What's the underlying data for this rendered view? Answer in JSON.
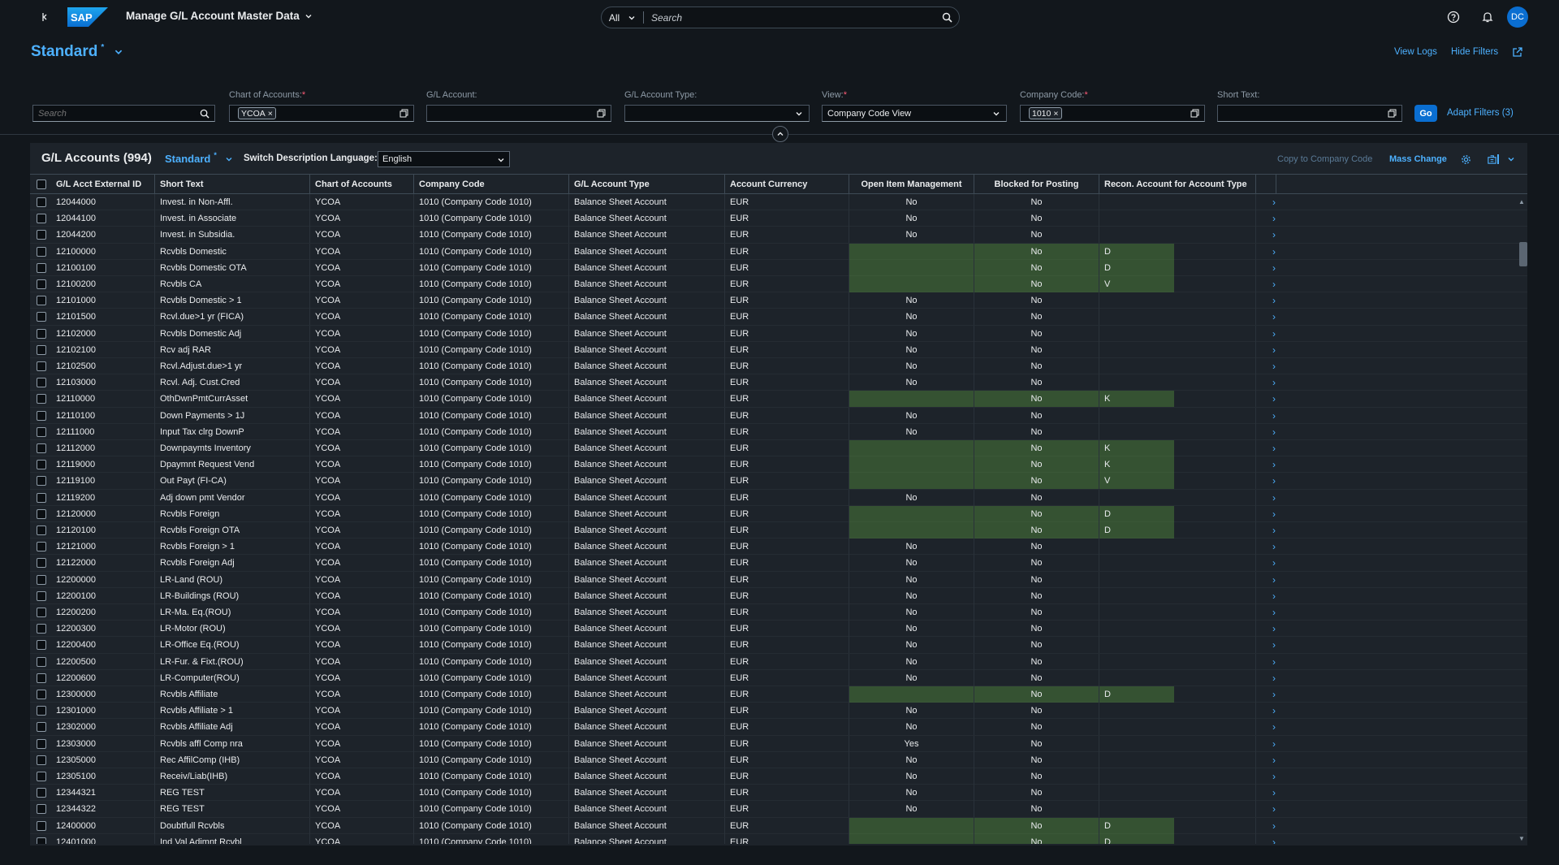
{
  "shell": {
    "back_icon": "back-icon",
    "logo_text": "SAP",
    "app_title": "Manage G/L Account Master Data",
    "search_scope": "All",
    "search_placeholder": "Search",
    "icons": [
      "help-icon",
      "notification-icon"
    ],
    "avatar_initials": "DC"
  },
  "header": {
    "variant": "Standard",
    "variant_mark": "*",
    "links": {
      "view_logs": "View Logs",
      "hide_filters": "Hide Filters"
    }
  },
  "filters": {
    "search_placeholder": "Search",
    "chart_of_accounts": {
      "label": "Chart of Accounts:",
      "required": "*",
      "token": "YCOA"
    },
    "gl_account": {
      "label": "G/L Account:",
      "value": ""
    },
    "gl_account_type": {
      "label": "G/L Account Type:",
      "value": ""
    },
    "view": {
      "label": "View:",
      "required": "*",
      "value": "Company Code View"
    },
    "company_code": {
      "label": "Company Code:",
      "required": "*",
      "token": "1010"
    },
    "short_text": {
      "label": "Short Text:",
      "value": ""
    },
    "go_label": "Go",
    "adapt_label": "Adapt Filters (3)"
  },
  "table": {
    "title": "G/L Accounts (994)",
    "variant": "Standard",
    "variant_mark": "*",
    "lang_label": "Switch Description Language:",
    "lang_value": "English",
    "copy_label": "Copy to Company Code",
    "mass_change_label": "Mass Change",
    "columns": [
      "G/L Acct External ID",
      "Short Text",
      "Chart of Accounts",
      "Company Code",
      "G/L Account Type",
      "Account Currency",
      "Open Item Management",
      "Blocked for Posting",
      "Recon. Account for Account Type"
    ],
    "rows": [
      [
        "12044000",
        "Invest. in Non-Affl.",
        "YCOA",
        "1010 (Company Code 1010)",
        "Balance Sheet Account",
        "EUR",
        "No",
        "No",
        ""
      ],
      [
        "12044100",
        "Invest. in Associate",
        "YCOA",
        "1010 (Company Code 1010)",
        "Balance Sheet Account",
        "EUR",
        "No",
        "No",
        ""
      ],
      [
        "12044200",
        "Invest. in Subsidia.",
        "YCOA",
        "1010 (Company Code 1010)",
        "Balance Sheet Account",
        "EUR",
        "No",
        "No",
        ""
      ],
      [
        "12100000",
        "Rcvbls Domestic",
        "YCOA",
        "1010 (Company Code 1010)",
        "Balance Sheet Account",
        "EUR",
        "",
        "No",
        "D"
      ],
      [
        "12100100",
        "Rcvbls Domestic OTA",
        "YCOA",
        "1010 (Company Code 1010)",
        "Balance Sheet Account",
        "EUR",
        "",
        "No",
        "D"
      ],
      [
        "12100200",
        "Rcvbls CA",
        "YCOA",
        "1010 (Company Code 1010)",
        "Balance Sheet Account",
        "EUR",
        "",
        "No",
        "V"
      ],
      [
        "12101000",
        "Rcvbls Domestic > 1",
        "YCOA",
        "1010 (Company Code 1010)",
        "Balance Sheet Account",
        "EUR",
        "No",
        "No",
        ""
      ],
      [
        "12101500",
        "Rcvl.due>1 yr (FICA)",
        "YCOA",
        "1010 (Company Code 1010)",
        "Balance Sheet Account",
        "EUR",
        "No",
        "No",
        ""
      ],
      [
        "12102000",
        "Rcvbls Domestic Adj",
        "YCOA",
        "1010 (Company Code 1010)",
        "Balance Sheet Account",
        "EUR",
        "No",
        "No",
        ""
      ],
      [
        "12102100",
        "Rcv adj RAR",
        "YCOA",
        "1010 (Company Code 1010)",
        "Balance Sheet Account",
        "EUR",
        "No",
        "No",
        ""
      ],
      [
        "12102500",
        "Rcvl.Adjust.due>1 yr",
        "YCOA",
        "1010 (Company Code 1010)",
        "Balance Sheet Account",
        "EUR",
        "No",
        "No",
        ""
      ],
      [
        "12103000",
        "Rcvl. Adj. Cust.Cred",
        "YCOA",
        "1010 (Company Code 1010)",
        "Balance Sheet Account",
        "EUR",
        "No",
        "No",
        ""
      ],
      [
        "12110000",
        "OthDwnPmtCurrAsset",
        "YCOA",
        "1010 (Company Code 1010)",
        "Balance Sheet Account",
        "EUR",
        "",
        "No",
        "K"
      ],
      [
        "12110100",
        "Down Payments > 1J",
        "YCOA",
        "1010 (Company Code 1010)",
        "Balance Sheet Account",
        "EUR",
        "No",
        "No",
        ""
      ],
      [
        "12111000",
        "Input Tax clrg DownP",
        "YCOA",
        "1010 (Company Code 1010)",
        "Balance Sheet Account",
        "EUR",
        "No",
        "No",
        ""
      ],
      [
        "12112000",
        "Downpaymts Inventory",
        "YCOA",
        "1010 (Company Code 1010)",
        "Balance Sheet Account",
        "EUR",
        "",
        "No",
        "K"
      ],
      [
        "12119000",
        "Dpaymnt Request Vend",
        "YCOA",
        "1010 (Company Code 1010)",
        "Balance Sheet Account",
        "EUR",
        "",
        "No",
        "K"
      ],
      [
        "12119100",
        "Out Payt (FI-CA)",
        "YCOA",
        "1010 (Company Code 1010)",
        "Balance Sheet Account",
        "EUR",
        "",
        "No",
        "V"
      ],
      [
        "12119200",
        "Adj down pmt Vendor",
        "YCOA",
        "1010 (Company Code 1010)",
        "Balance Sheet Account",
        "EUR",
        "No",
        "No",
        ""
      ],
      [
        "12120000",
        "Rcvbls Foreign",
        "YCOA",
        "1010 (Company Code 1010)",
        "Balance Sheet Account",
        "EUR",
        "",
        "No",
        "D"
      ],
      [
        "12120100",
        "Rcvbls Foreign OTA",
        "YCOA",
        "1010 (Company Code 1010)",
        "Balance Sheet Account",
        "EUR",
        "",
        "No",
        "D"
      ],
      [
        "12121000",
        "Rcvbls Foreign > 1",
        "YCOA",
        "1010 (Company Code 1010)",
        "Balance Sheet Account",
        "EUR",
        "No",
        "No",
        ""
      ],
      [
        "12122000",
        "Rcvbls Foreign Adj",
        "YCOA",
        "1010 (Company Code 1010)",
        "Balance Sheet Account",
        "EUR",
        "No",
        "No",
        ""
      ],
      [
        "12200000",
        "LR-Land (ROU)",
        "YCOA",
        "1010 (Company Code 1010)",
        "Balance Sheet Account",
        "EUR",
        "No",
        "No",
        ""
      ],
      [
        "12200100",
        "LR-Buildings (ROU)",
        "YCOA",
        "1010 (Company Code 1010)",
        "Balance Sheet Account",
        "EUR",
        "No",
        "No",
        ""
      ],
      [
        "12200200",
        "LR-Ma. Eq.(ROU)",
        "YCOA",
        "1010 (Company Code 1010)",
        "Balance Sheet Account",
        "EUR",
        "No",
        "No",
        ""
      ],
      [
        "12200300",
        "LR-Motor (ROU)",
        "YCOA",
        "1010 (Company Code 1010)",
        "Balance Sheet Account",
        "EUR",
        "No",
        "No",
        ""
      ],
      [
        "12200400",
        "LR-Office Eq.(ROU)",
        "YCOA",
        "1010 (Company Code 1010)",
        "Balance Sheet Account",
        "EUR",
        "No",
        "No",
        ""
      ],
      [
        "12200500",
        "LR-Fur. & Fixt.(ROU)",
        "YCOA",
        "1010 (Company Code 1010)",
        "Balance Sheet Account",
        "EUR",
        "No",
        "No",
        ""
      ],
      [
        "12200600",
        "LR-Computer(ROU)",
        "YCOA",
        "1010 (Company Code 1010)",
        "Balance Sheet Account",
        "EUR",
        "No",
        "No",
        ""
      ],
      [
        "12300000",
        "Rcvbls Affiliate",
        "YCOA",
        "1010 (Company Code 1010)",
        "Balance Sheet Account",
        "EUR",
        "",
        "No",
        "D"
      ],
      [
        "12301000",
        "Rcvbls Affiliate > 1",
        "YCOA",
        "1010 (Company Code 1010)",
        "Balance Sheet Account",
        "EUR",
        "No",
        "No",
        ""
      ],
      [
        "12302000",
        "Rcvbls Affiliate Adj",
        "YCOA",
        "1010 (Company Code 1010)",
        "Balance Sheet Account",
        "EUR",
        "No",
        "No",
        ""
      ],
      [
        "12303000",
        "Rcvbls affl Comp nra",
        "YCOA",
        "1010 (Company Code 1010)",
        "Balance Sheet Account",
        "EUR",
        "Yes",
        "No",
        ""
      ],
      [
        "12305000",
        "Rec AffilComp (IHB)",
        "YCOA",
        "1010 (Company Code 1010)",
        "Balance Sheet Account",
        "EUR",
        "No",
        "No",
        ""
      ],
      [
        "12305100",
        "Receiv/Liab(IHB)",
        "YCOA",
        "1010 (Company Code 1010)",
        "Balance Sheet Account",
        "EUR",
        "No",
        "No",
        ""
      ],
      [
        "12344321",
        "REG TEST",
        "YCOA",
        "1010 (Company Code 1010)",
        "Balance Sheet Account",
        "EUR",
        "No",
        "No",
        ""
      ],
      [
        "12344322",
        "REG TEST",
        "YCOA",
        "1010 (Company Code 1010)",
        "Balance Sheet Account",
        "EUR",
        "No",
        "No",
        ""
      ],
      [
        "12400000",
        "Doubtfull Rcvbls",
        "YCOA",
        "1010 (Company Code 1010)",
        "Balance Sheet Account",
        "EUR",
        "",
        "No",
        "D"
      ],
      [
        "12401000",
        "Ind Val Adjmnt Rcvbl",
        "YCOA",
        "1010 (Company Code 1010)",
        "Balance Sheet Account",
        "EUR",
        "",
        "No",
        "D"
      ]
    ]
  },
  "colors": {
    "accent": "#4db1ff",
    "background": "#12171c",
    "panel": "#1d232a",
    "highlight": "#3c6a2f",
    "brand": "#0a6ed1",
    "required": "#ff5c77"
  }
}
